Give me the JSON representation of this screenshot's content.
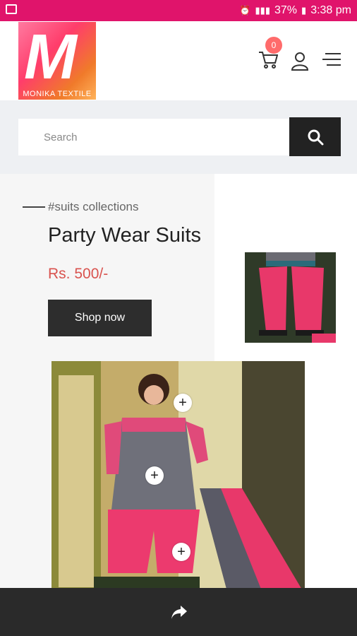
{
  "status_bar": {
    "battery": "37%",
    "time": "3:38 pm"
  },
  "logo": {
    "letter": "M",
    "caption": "MONIKA TEXTILE"
  },
  "header": {
    "cart_count": "0",
    "icons": [
      "cart-icon",
      "user-icon",
      "menu-icon"
    ]
  },
  "search": {
    "placeholder": "Search",
    "icon": "search-icon"
  },
  "hero": {
    "tag": "#suits collections",
    "title": "Party Wear Suits",
    "price": "Rs. 500/-",
    "cta": "Shop now"
  },
  "hotspots": [
    "+",
    "+",
    "+"
  ],
  "footer": {
    "icon": "share-icon"
  },
  "colors": {
    "status_bar": "#e0146b",
    "price": "#d9534f",
    "dark": "#222222",
    "badge": "#ff6b6b"
  }
}
